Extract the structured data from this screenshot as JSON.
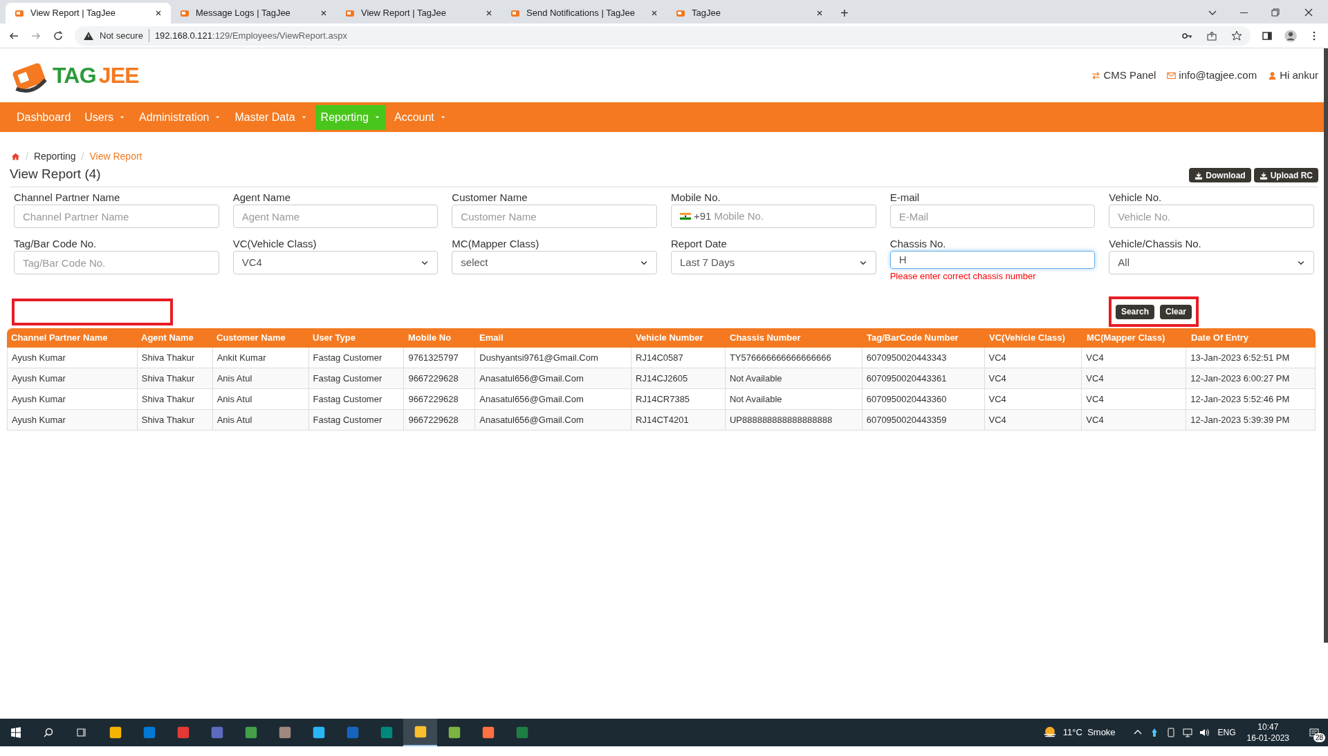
{
  "browser": {
    "tabs": [
      {
        "title": "View Report | TagJee",
        "selected": true
      },
      {
        "title": "Message Logs | TagJee",
        "selected": false
      },
      {
        "title": "View Report | TagJee",
        "selected": false
      },
      {
        "title": "Send Notifications | TagJee",
        "selected": false
      },
      {
        "title": "TagJee",
        "selected": false
      }
    ],
    "new_tab": "+",
    "security": "Not secure",
    "url_host": "192.168.0.121",
    "url_rest": ":129/Employees/ViewReport.aspx"
  },
  "header": {
    "logo_left": "TAG",
    "logo_right": "JEE",
    "links": [
      "CMS Panel",
      "info@tagjee.com",
      "Hi ankur"
    ]
  },
  "nav": [
    {
      "label": "Dashboard",
      "dropdown": false,
      "selected": false
    },
    {
      "label": "Users",
      "dropdown": true,
      "selected": false
    },
    {
      "label": "Administration",
      "dropdown": true,
      "selected": false
    },
    {
      "label": "Master Data",
      "dropdown": true,
      "selected": false
    },
    {
      "label": "Reporting",
      "dropdown": true,
      "selected": true
    },
    {
      "label": "Account",
      "dropdown": true,
      "selected": false
    }
  ],
  "breadcrumb": [
    "Reporting",
    "View Report"
  ],
  "breadcrumb_separator": "/",
  "title": "View Report (4)",
  "top_buttons": [
    "Download",
    "Upload RC"
  ],
  "filters": [
    {
      "kind": "input",
      "label": "Channel Partner Name",
      "placeholder": "Channel Partner Name"
    },
    {
      "kind": "input",
      "label": "Agent Name",
      "placeholder": "Agent Name"
    },
    {
      "kind": "input",
      "label": "Customer Name",
      "placeholder": "Customer Name"
    },
    {
      "kind": "phone",
      "label": "Mobile No.",
      "prefix": "+91",
      "placeholder": "Mobile No."
    },
    {
      "kind": "input",
      "label": "E-mail",
      "placeholder": "E-Mail"
    },
    {
      "kind": "input",
      "label": "Vehicle No.",
      "placeholder": "Vehicle No."
    },
    {
      "kind": "input",
      "label": "Tag/Bar Code No.",
      "placeholder": "Tag/Bar Code No."
    },
    {
      "kind": "select",
      "label": "VC(Vehicle Class)",
      "value": "VC4"
    },
    {
      "kind": "select",
      "label": "MC(Mapper Class)",
      "value": "select"
    },
    {
      "kind": "select",
      "label": "Report Date",
      "value": "Last 7 Days"
    },
    {
      "kind": "input",
      "label": "Chassis No.",
      "value": "H",
      "focused": true,
      "error": "Please enter correct chassis number"
    },
    {
      "kind": "select",
      "label": "Vehicle/Chassis No.",
      "value": "All"
    }
  ],
  "highlight_left": true,
  "actions": {
    "highlighted": true,
    "buttons": [
      "Search",
      "Clear"
    ]
  },
  "table": {
    "columns": [
      "Channel Partner Name",
      "Agent Name",
      "Customer Name",
      "User Type",
      "Mobile No",
      "Email",
      "Vehicle Number",
      "Chassis Number",
      "Tag/BarCode Number",
      "VC(Vehicle Class)",
      "MC(Mapper Class)",
      "Date Of Entry"
    ],
    "rows": [
      [
        "Ayush Kumar",
        "Shiva Thakur",
        "Ankit Kumar",
        "Fastag Customer",
        "9761325797",
        "Dushyantsi9761@Gmail.Com",
        "RJ14C0587",
        "TY576666666666666666",
        "6070950020443343",
        "VC4",
        "VC4",
        "13-Jan-2023 6:52:51 PM"
      ],
      [
        "Ayush Kumar",
        "Shiva Thakur",
        "Anis Atul",
        "Fastag Customer",
        "9667229628",
        "Anasatul656@Gmail.Com",
        "RJ14CJ2605",
        "Not Available",
        "6070950020443361",
        "VC4",
        "VC4",
        "12-Jan-2023 6:00:27 PM"
      ],
      [
        "Ayush Kumar",
        "Shiva Thakur",
        "Anis Atul",
        "Fastag Customer",
        "9667229628",
        "Anasatul656@Gmail.Com",
        "RJ14CR7385",
        "Not Available",
        "6070950020443360",
        "VC4",
        "VC4",
        "12-Jan-2023 5:52:46 PM"
      ],
      [
        "Ayush Kumar",
        "Shiva Thakur",
        "Anis Atul",
        "Fastag Customer",
        "9667229628",
        "Anasatul656@Gmail.Com",
        "RJ14CT4201",
        "UP888888888888888888",
        "6070950020443359",
        "VC4",
        "VC4",
        "12-Jan-2023 5:39:39 PM"
      ]
    ]
  },
  "taskbar": {
    "apps": [
      {
        "color": "#f4b400",
        "selected": false
      },
      {
        "color": "#0078d4",
        "selected": false
      },
      {
        "color": "#e53935",
        "selected": false
      },
      {
        "color": "#5c6bc0",
        "selected": false
      },
      {
        "color": "#43a047",
        "selected": false
      },
      {
        "color": "#a1887f",
        "selected": false
      },
      {
        "color": "#29b6f6",
        "selected": false
      },
      {
        "color": "#1565c0",
        "selected": false
      },
      {
        "color": "#00897b",
        "selected": false
      },
      {
        "color": "#fbc02d",
        "selected": true
      },
      {
        "color": "#7cb342",
        "selected": false
      },
      {
        "color": "#ff7043",
        "selected": false
      },
      {
        "color": "#1e7e45",
        "selected": false
      }
    ],
    "weather": "11°C  Smoke",
    "lang": "ENG",
    "time": "10:47",
    "date": "16-01-2023",
    "notifications": "28"
  }
}
